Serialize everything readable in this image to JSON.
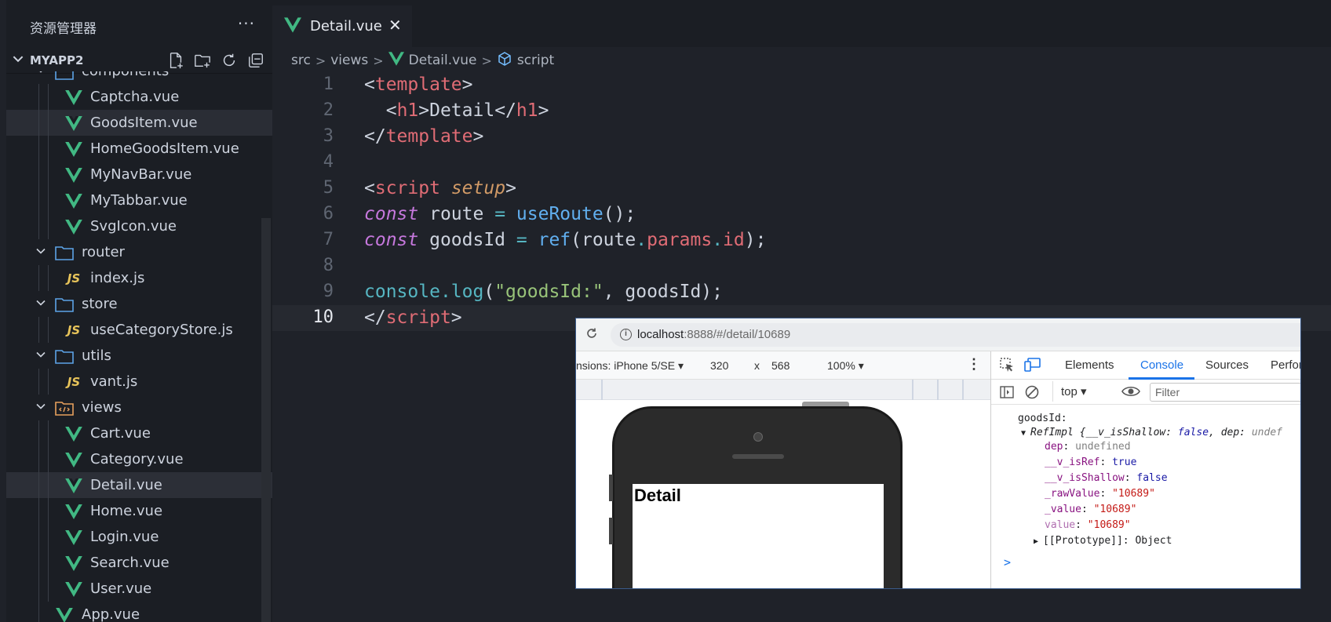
{
  "explorer": {
    "title": "资源管理器",
    "more": "···",
    "project": "MYAPP2",
    "tree": [
      {
        "label": "components",
        "type": "folder",
        "depth": 1,
        "open": true,
        "partial": true
      },
      {
        "label": "Captcha.vue",
        "type": "vue",
        "depth": 2
      },
      {
        "label": "GoodsItem.vue",
        "type": "vue",
        "depth": 2,
        "state": "hover"
      },
      {
        "label": "HomeGoodsItem.vue",
        "type": "vue",
        "depth": 2
      },
      {
        "label": "MyNavBar.vue",
        "type": "vue",
        "depth": 2
      },
      {
        "label": "MyTabbar.vue",
        "type": "vue",
        "depth": 2
      },
      {
        "label": "SvgIcon.vue",
        "type": "vue",
        "depth": 2
      },
      {
        "label": "router",
        "type": "folder",
        "depth": 1,
        "open": true
      },
      {
        "label": "index.js",
        "type": "js",
        "depth": 2
      },
      {
        "label": "store",
        "type": "folder",
        "depth": 1,
        "open": true
      },
      {
        "label": "useCategoryStore.js",
        "type": "js",
        "depth": 2
      },
      {
        "label": "utils",
        "type": "folder",
        "depth": 1,
        "open": true
      },
      {
        "label": "vant.js",
        "type": "js",
        "depth": 2
      },
      {
        "label": "views",
        "type": "views-folder",
        "depth": 1,
        "open": true
      },
      {
        "label": "Cart.vue",
        "type": "vue",
        "depth": 2
      },
      {
        "label": "Category.vue",
        "type": "vue",
        "depth": 2
      },
      {
        "label": "Detail.vue",
        "type": "vue",
        "depth": 2,
        "state": "selected"
      },
      {
        "label": "Home.vue",
        "type": "vue",
        "depth": 2
      },
      {
        "label": "Login.vue",
        "type": "vue",
        "depth": 2
      },
      {
        "label": "Search.vue",
        "type": "vue",
        "depth": 2
      },
      {
        "label": "User.vue",
        "type": "vue",
        "depth": 2
      },
      {
        "label": "App.vue",
        "type": "vue",
        "depth": 1
      }
    ],
    "js_badge": "JS"
  },
  "tab": {
    "label": "Detail.vue",
    "close": "✕"
  },
  "breadcrumb": {
    "src": "src",
    "views": "views",
    "file": "Detail.vue",
    "symbol": "script",
    "sep": ">"
  },
  "code": {
    "lines": [
      "1",
      "2",
      "3",
      "4",
      "5",
      "6",
      "7",
      "8",
      "9",
      "10"
    ],
    "current_line": "10"
  },
  "browser": {
    "url_host": "localhost",
    "url_rest": ":8888/#/detail/10689",
    "device_label": "nsions: iPhone 5/SE",
    "width": "320",
    "times": "x",
    "height": "568",
    "zoom": "100%",
    "page_heading": "Detail",
    "devtools_tabs": [
      "Elements",
      "Console",
      "Sources",
      "Perfor"
    ],
    "active_tab": "Console",
    "context": "top",
    "filter_placeholder": "Filter",
    "console": {
      "log_label": "goodsId:",
      "refimpl_head": "RefImpl",
      "refimpl_preview_open": " {__v_isShallow: ",
      "refimpl_preview_false": "false",
      "refimpl_preview_mid": ", dep: ",
      "refimpl_preview_end": "undef",
      "dep_key": "dep",
      "dep_val": "undefined",
      "isref_key": "__v_isRef",
      "isref_val": "true",
      "isshallow_key": "__v_isShallow",
      "isshallow_val": "false",
      "rawvalue_key": "_rawValue",
      "rawvalue_val": "\"10689\"",
      "value_key": "_value",
      "value_val": "\"10689\"",
      "getter_key": "value",
      "getter_val": "\"10689\"",
      "proto": "[[Prototype]]: Object",
      "prompt": ">"
    }
  },
  "colors": {
    "vue": "#41b883",
    "js": "#e8c45a",
    "folder": "#5da4e8",
    "accent": "#1a73e8"
  }
}
